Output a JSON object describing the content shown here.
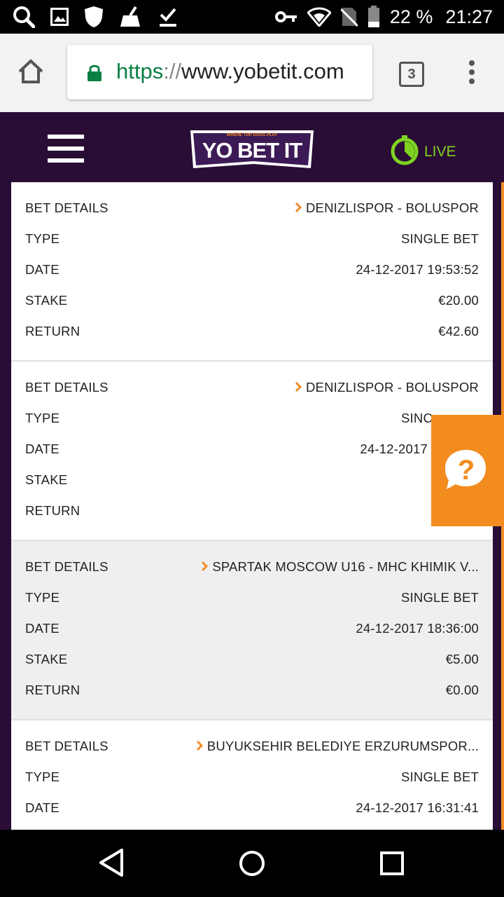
{
  "status_bar": {
    "battery": "22 %",
    "time": "21:27",
    "icons": [
      "search-icon",
      "gallery-icon",
      "shield-icon",
      "cleaner-icon",
      "download-icon",
      "key-icon",
      "wifi-icon",
      "no-sim-icon",
      "battery-icon"
    ]
  },
  "browser": {
    "url_scheme": "https",
    "url_sep": "://",
    "url_host": "www.yobetit.com",
    "tab_count": "3"
  },
  "site": {
    "logo_text": "YO BET IT",
    "logo_tagline": "WHERE TOP DOGS PLAY",
    "live_label": "LIVE"
  },
  "labels": {
    "bet_details": "BET DETAILS",
    "type": "TYPE",
    "date": "DATE",
    "stake": "STAKE",
    "return": "RETURN"
  },
  "bets": [
    {
      "event": "DENIZLISPOR - BOLUSPOR",
      "type": "SINGLE BET",
      "date": "24-12-2017 19:53:52",
      "stake": "€20.00",
      "return": "€42.60"
    },
    {
      "event": "DENIZLISPOR - BOLUSPOR",
      "type": "SINC",
      "date": "24-12-2017",
      "stake": "",
      "return": ""
    },
    {
      "event": "SPARTAK MOSCOW U16 - MHC KHIMIK V...",
      "type": "SINGLE BET",
      "date": "24-12-2017 18:36:00",
      "stake": "€5.00",
      "return": "€0.00"
    },
    {
      "event": "BUYUKSEHIR BELEDIYE ERZURUMSPOR...",
      "type": "SINGLE BET",
      "date": "24-12-2017 16:31:41",
      "stake": "",
      "return": ""
    }
  ],
  "help_widget": {
    "symbol": "?"
  },
  "colors": {
    "accent": "#f28c28",
    "header_bg": "#2a0d35",
    "live_green": "#7ed321",
    "url_green": "#0b8043"
  }
}
